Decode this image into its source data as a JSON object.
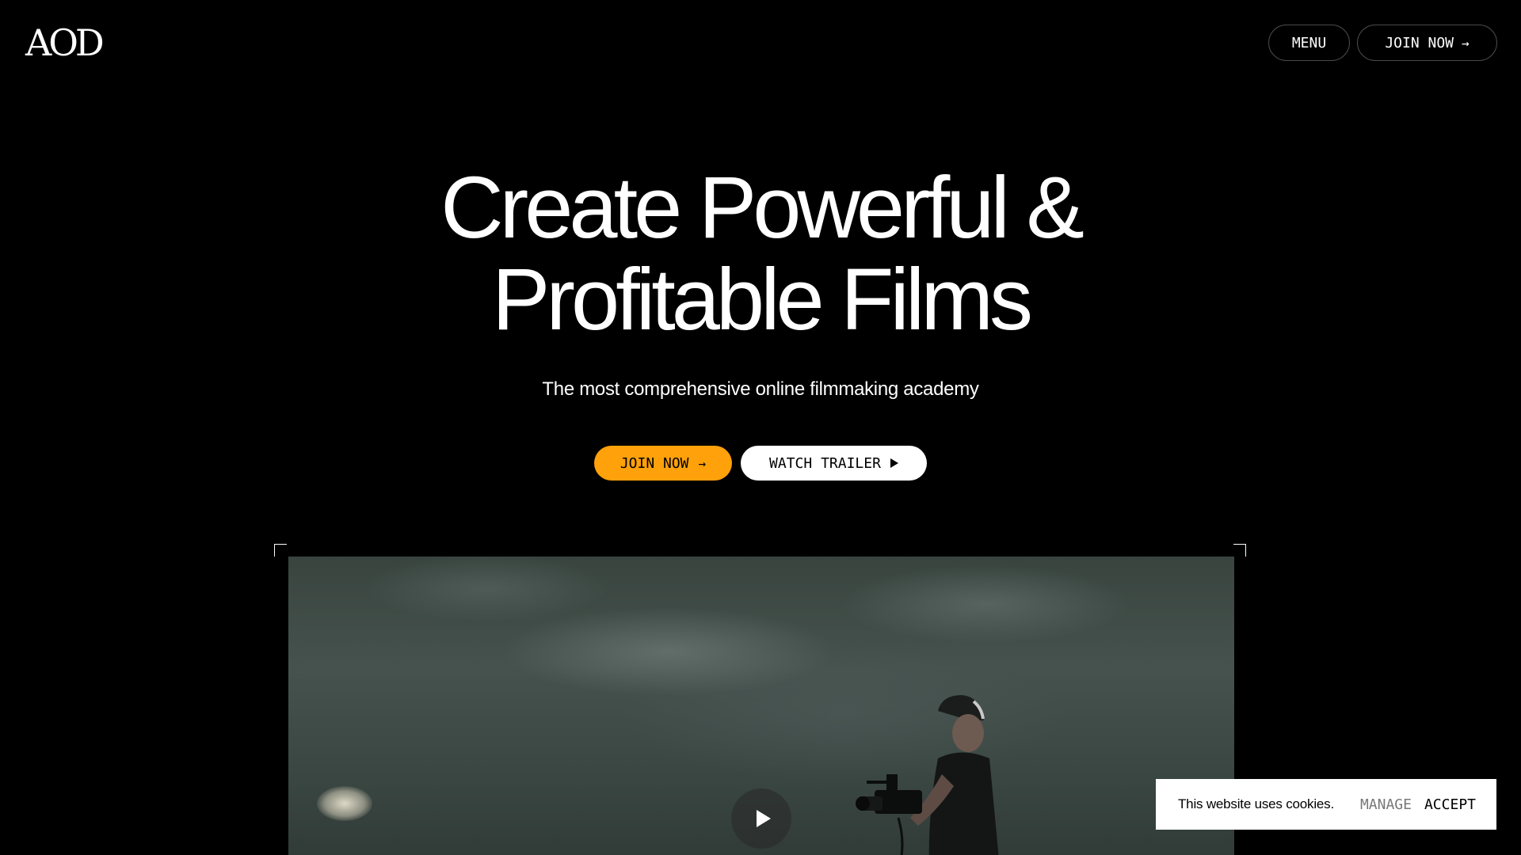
{
  "header": {
    "logo": "AOD",
    "menu_label": "MENU",
    "join_label": "JOIN NOW",
    "arrow": "→"
  },
  "hero": {
    "title_line1": "Create Powerful &",
    "title_line2": "Profitable Films",
    "subtitle": "The most comprehensive online filmmaking academy",
    "cta_join": "JOIN NOW",
    "cta_trailer": "WATCH TRAILER"
  },
  "video": {
    "play_icon": "play-icon"
  },
  "cookie_banner": {
    "text": "This website uses cookies.",
    "manage_label": "MANAGE",
    "accept_label": "ACCEPT"
  },
  "colors": {
    "background": "#000000",
    "accent": "#ffa10a",
    "text": "#ffffff"
  }
}
